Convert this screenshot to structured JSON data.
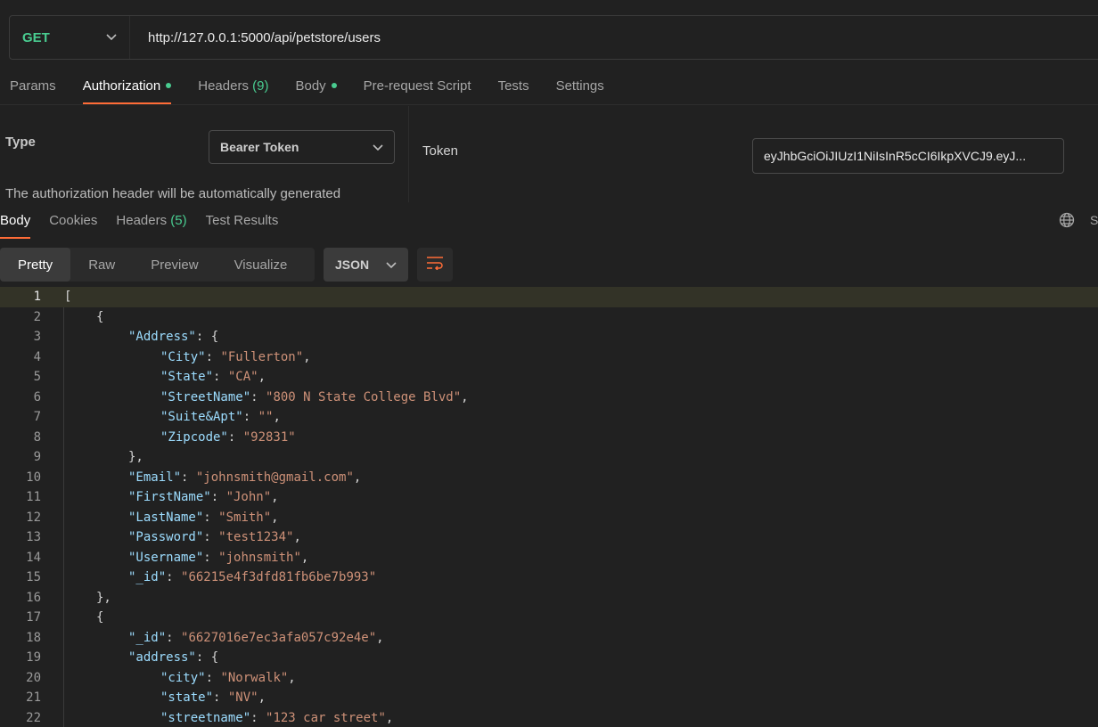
{
  "request": {
    "method": "GET",
    "url": "http://127.0.0.1:5000/api/petstore/users"
  },
  "request_tabs": [
    {
      "label": "Params",
      "active": false
    },
    {
      "label": "Authorization",
      "active": true,
      "dot": true
    },
    {
      "label": "Headers",
      "count": "(9)",
      "active": false
    },
    {
      "label": "Body",
      "active": false,
      "dot": true
    },
    {
      "label": "Pre-request Script",
      "active": false
    },
    {
      "label": "Tests",
      "active": false
    },
    {
      "label": "Settings",
      "active": false
    }
  ],
  "auth": {
    "type_label": "Type",
    "type_value": "Bearer Token",
    "note": "The authorization header will be automatically generated",
    "token_label": "Token",
    "token_value": "eyJhbGciOiJIUzI1NiIsInR5cCI6IkpXVCJ9.eyJ..."
  },
  "response_tabs": [
    {
      "label": "Body",
      "active": true
    },
    {
      "label": "Cookies",
      "active": false
    },
    {
      "label": "Headers",
      "count": "(5)",
      "active": false
    },
    {
      "label": "Test Results",
      "active": false
    }
  ],
  "response_right_cut": "S",
  "view_modes": [
    {
      "label": "Pretty",
      "active": true
    },
    {
      "label": "Raw",
      "active": false
    },
    {
      "label": "Preview",
      "active": false
    },
    {
      "label": "Visualize",
      "active": false
    }
  ],
  "format": "JSON",
  "colors": {
    "accent": "#ff6c37",
    "method_get": "#49cc90",
    "json_key": "#9cdcfe",
    "json_string": "#ce9178"
  },
  "code_lines": [
    {
      "n": "1",
      "indent": 0,
      "text": "["
    },
    {
      "n": "2",
      "indent": 1,
      "text": "{"
    },
    {
      "n": "3",
      "indent": 2,
      "key": "\"Address\"",
      "rest": ": {"
    },
    {
      "n": "4",
      "indent": 3,
      "key": "\"City\"",
      "val": "\"Fullerton\"",
      "tail": ","
    },
    {
      "n": "5",
      "indent": 3,
      "key": "\"State\"",
      "val": "\"CA\"",
      "tail": ","
    },
    {
      "n": "6",
      "indent": 3,
      "key": "\"StreetName\"",
      "val": "\"800 N State College Blvd\"",
      "tail": ","
    },
    {
      "n": "7",
      "indent": 3,
      "key": "\"Suite&Apt\"",
      "val": "\"\"",
      "tail": ","
    },
    {
      "n": "8",
      "indent": 3,
      "key": "\"Zipcode\"",
      "val": "\"92831\"",
      "tail": ""
    },
    {
      "n": "9",
      "indent": 2,
      "text": "},"
    },
    {
      "n": "10",
      "indent": 2,
      "key": "\"Email\"",
      "val": "\"johnsmith@gmail.com\"",
      "tail": ","
    },
    {
      "n": "11",
      "indent": 2,
      "key": "\"FirstName\"",
      "val": "\"John\"",
      "tail": ","
    },
    {
      "n": "12",
      "indent": 2,
      "key": "\"LastName\"",
      "val": "\"Smith\"",
      "tail": ","
    },
    {
      "n": "13",
      "indent": 2,
      "key": "\"Password\"",
      "val": "\"test1234\"",
      "tail": ","
    },
    {
      "n": "14",
      "indent": 2,
      "key": "\"Username\"",
      "val": "\"johnsmith\"",
      "tail": ","
    },
    {
      "n": "15",
      "indent": 2,
      "key": "\"_id\"",
      "val": "\"66215e4f3dfd81fb6be7b993\"",
      "tail": ""
    },
    {
      "n": "16",
      "indent": 1,
      "text": "},"
    },
    {
      "n": "17",
      "indent": 1,
      "text": "{"
    },
    {
      "n": "18",
      "indent": 2,
      "key": "\"_id\"",
      "val": "\"6627016e7ec3afa057c92e4e\"",
      "tail": ","
    },
    {
      "n": "19",
      "indent": 2,
      "key": "\"address\"",
      "rest": ": {"
    },
    {
      "n": "20",
      "indent": 3,
      "key": "\"city\"",
      "val": "\"Norwalk\"",
      "tail": ","
    },
    {
      "n": "21",
      "indent": 3,
      "key": "\"state\"",
      "val": "\"NV\"",
      "tail": ","
    },
    {
      "n": "22",
      "indent": 3,
      "key": "\"streetname\"",
      "val": "\"123 car street\"",
      "tail": ","
    }
  ]
}
